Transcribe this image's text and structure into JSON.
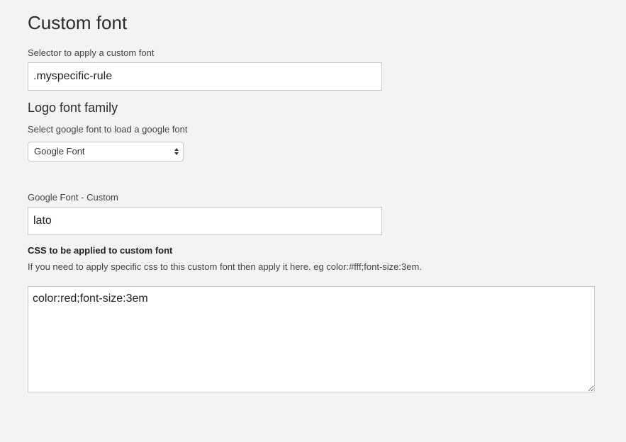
{
  "custom_font": {
    "heading": "Custom font",
    "selector_label": "Selector to apply a custom font",
    "selector_value": ".myspecific-rule"
  },
  "logo_font": {
    "heading": "Logo font family",
    "select_label": "Select google font to load a google font",
    "select_value": "Google Font",
    "custom_label": "Google Font - Custom",
    "custom_value": "lato"
  },
  "css_section": {
    "label": "CSS to be applied to custom font",
    "help": "If you need to apply specific css to this custom font then apply it here. eg color:#fff;font-size:3em.",
    "value": "color:red;font-size:3em"
  }
}
